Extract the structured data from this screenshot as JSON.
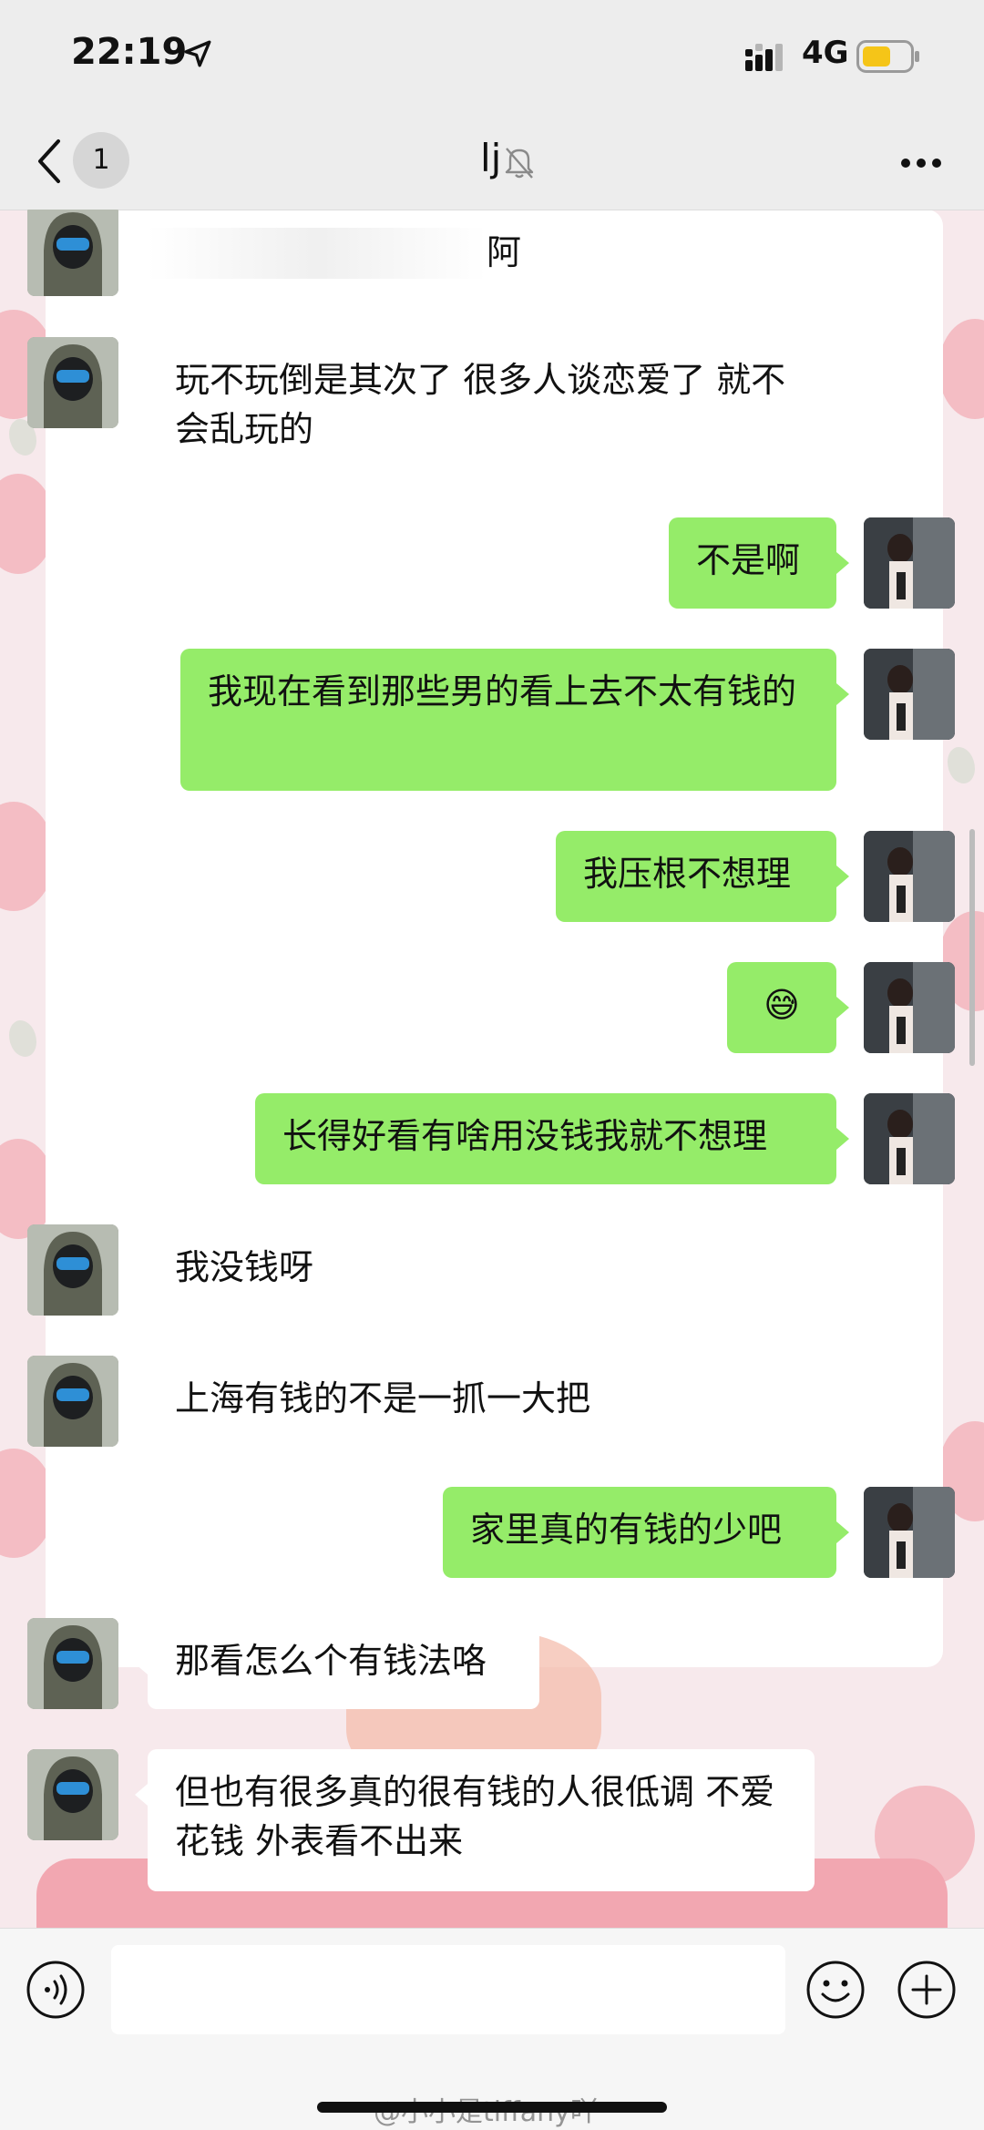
{
  "status_bar": {
    "time": "22:19",
    "network": "4G",
    "battery_color": "#f5c518"
  },
  "nav": {
    "unread_count": "1",
    "title": "lj"
  },
  "messages": [
    {
      "side": "left",
      "text": "阿",
      "partially_hidden": true
    },
    {
      "side": "left",
      "text": "玩不玩倒是其次了 很多人谈恋爱了 就不会乱玩的"
    },
    {
      "side": "right",
      "text": "不是啊"
    },
    {
      "side": "right",
      "text": "我现在看到那些男的看上去不太有钱的"
    },
    {
      "side": "right",
      "text": "我压根不想理"
    },
    {
      "side": "right",
      "text": "😅"
    },
    {
      "side": "right",
      "text": "长得好看有啥用没钱我就不想理"
    },
    {
      "side": "left",
      "text": "我没钱呀"
    },
    {
      "side": "left",
      "text": "上海有钱的不是一抓一大把"
    },
    {
      "side": "right",
      "text": "家里真的有钱的少吧"
    },
    {
      "side": "left",
      "text": "那看怎么个有钱法咯"
    },
    {
      "side": "left",
      "text": "但也有很多真的很有钱的人很低调 不爱花钱 外表看不出来"
    }
  ],
  "input": {
    "placeholder": ""
  },
  "watermark": "@小小是tiffany吖",
  "colors": {
    "sent_bubble": "#95ec69",
    "received_bubble": "#ffffff",
    "bar_bg": "#ededed"
  },
  "icons": [
    "location-arrow-icon",
    "signal-icon",
    "battery-icon",
    "back-icon",
    "mute-bell-icon",
    "more-icon",
    "voice-icon",
    "emoji-icon",
    "plus-icon"
  ]
}
